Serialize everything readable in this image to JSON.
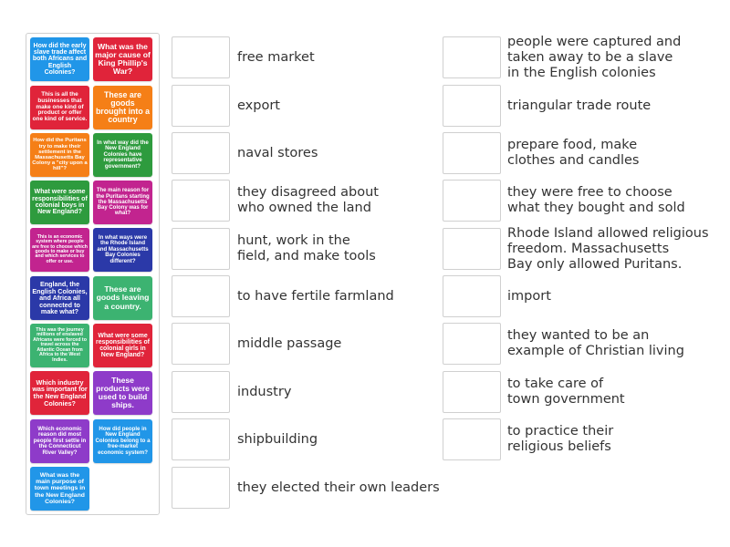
{
  "cards": [
    {
      "text": "How did the early slave trade affect both Africans and English Colonies?",
      "color": "#2196e8",
      "fs": 7
    },
    {
      "text": "What was the major cause of King Phillip's War?",
      "color": "#e0243a",
      "fs": 8.6
    },
    {
      "text": "This is all the businesses that make one kind of product or offer one kind of service.",
      "color": "#e0243a",
      "fs": 6.4
    },
    {
      "text": "These are goods brought into a country",
      "color": "#f57f17",
      "fs": 8.8
    },
    {
      "text": "How did the Puritans try to make their settlement in the Massachusetts Bay Colony a \"city upon a hill\"?",
      "color": "#f57f17",
      "fs": 5.9
    },
    {
      "text": "In what way did the New England Colonies have representative government?",
      "color": "#2e9b3e",
      "fs": 6.2
    },
    {
      "text": "What were some responsibilities of colonial boys in New England?",
      "color": "#2e9b3e",
      "fs": 7.1
    },
    {
      "text": "The main reason for the Puritans starting the Massachusetts Bay Colony was for what?",
      "color": "#c2248f",
      "fs": 6
    },
    {
      "text": "This is an economic system where people are free to choose which goods to make or buy and which services to offer or use.",
      "color": "#c2248f",
      "fs": 5.2
    },
    {
      "text": "In what ways were the Rhode Island and Massachusetts Bay Colonies different?",
      "color": "#2b39a8",
      "fs": 6.1
    },
    {
      "text": "England, the English Colonies, and Africa all connected to make what?",
      "color": "#2b39a8",
      "fs": 7.2
    },
    {
      "text": "These are goods leaving a country.",
      "color": "#3cb371",
      "fs": 8.6
    },
    {
      "text": "This was the journey millions of enslaved Africans were forced to travel across the Atlantic Ocean from Africa to the West Indies.",
      "color": "#3cb371",
      "fs": 5.3
    },
    {
      "text": "What were some responsibilities of colonial girls in New England?",
      "color": "#e0243a",
      "fs": 6.9
    },
    {
      "text": "Which industry was important for the New England Colonies?",
      "color": "#e0243a",
      "fs": 7.2
    },
    {
      "text": "These products were used to build ships.",
      "color": "#8e3bc9",
      "fs": 8.6
    },
    {
      "text": "Which economic reason did most people first settle in the Connecticut River Valley?",
      "color": "#8e3bc9",
      "fs": 6.1
    },
    {
      "text": "How did people in New England Colonies belong to a free-market economic system?",
      "color": "#2196e8",
      "fs": 6.1
    },
    {
      "text": "What was the main purpose of town meetings in the New England Colonies?",
      "color": "#2196e8",
      "fs": 6.8
    }
  ],
  "left_answers": [
    "free market",
    "export",
    "naval stores",
    "they disagreed about\nwho owned the land",
    "hunt, work in the\nfield, and make tools",
    "to have fertile farmland",
    "middle passage",
    "industry",
    "shipbuilding",
    "they elected their own leaders"
  ],
  "right_answers": [
    "people were captured and\ntaken away to be a slave\nin the English colonies",
    "triangular trade route",
    "prepare food, make\nclothes and candles",
    "they were free to choose\nwhat they bought and sold",
    "Rhode Island allowed religious\nfreedom. Massachusetts\nBay only allowed Puritans.",
    "import",
    "they wanted to be an\nexample of Christian living",
    "to take care of\ntown government",
    "to practice their\nreligious beliefs"
  ]
}
